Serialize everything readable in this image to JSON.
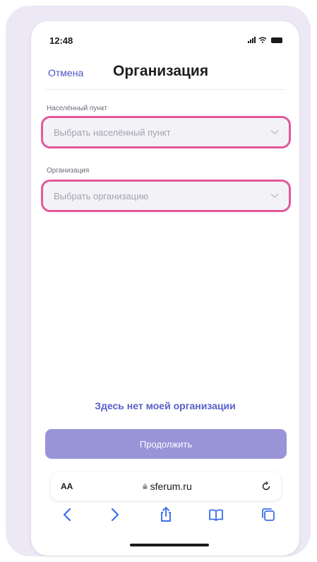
{
  "status_bar": {
    "time": "12:48",
    "icons": [
      "signal-icon",
      "wifi-icon",
      "battery-icon"
    ]
  },
  "header": {
    "cancel_label": "Отмена",
    "title": "Организация"
  },
  "fields": {
    "locality": {
      "label": "Населённый пункт",
      "placeholder": "Выбрать населённый пункт"
    },
    "organization": {
      "label": "Организация",
      "placeholder": "Выбрать организацию"
    }
  },
  "no_org_link": "Здесь нет моей организации",
  "continue_label": "Продолжить",
  "browser": {
    "text_size_label": "AA",
    "url": "sferum.ru",
    "toolbar_icons": [
      "back-icon",
      "forward-icon",
      "share-icon",
      "bookmarks-icon",
      "tabs-icon"
    ]
  },
  "colors": {
    "accent": "#4a56c4",
    "highlight": "#e4589a",
    "button": "#9993d8",
    "link": "#5860c9"
  }
}
